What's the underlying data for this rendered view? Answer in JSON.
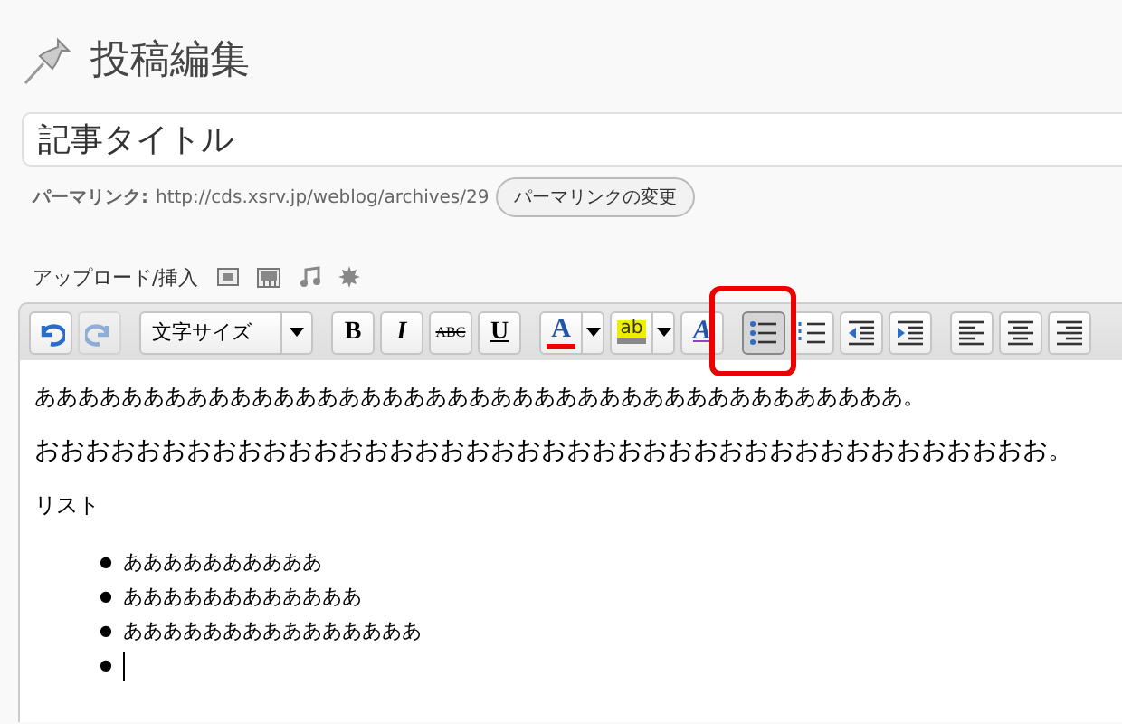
{
  "page_title": "投稿編集",
  "title_field": {
    "value": "記事タイトル"
  },
  "permalink": {
    "label": "パーマリンク:",
    "url": "http://cds.xsrv.jp/weblog/archives/29",
    "button": "パーマリンクの変更"
  },
  "upload": {
    "label": "アップロード/挿入"
  },
  "toolbar": [
    {
      "kind": "undo",
      "disabled": false,
      "selected": false
    },
    {
      "kind": "redo",
      "disabled": true,
      "selected": false
    },
    {
      "kind": "select",
      "label": "文字サイズ",
      "disabled": false,
      "selected": false
    },
    {
      "kind": "bold",
      "label": "B",
      "disabled": false,
      "selected": false
    },
    {
      "kind": "italic",
      "label": "I",
      "disabled": false,
      "selected": false
    },
    {
      "kind": "strike",
      "label": "ABC",
      "disabled": false,
      "selected": false
    },
    {
      "kind": "underline",
      "label": "U",
      "disabled": false,
      "selected": false
    },
    {
      "kind": "forecolor",
      "label": "A",
      "disabled": false,
      "selected": false
    },
    {
      "kind": "highlight",
      "label": "ab",
      "disabled": false,
      "selected": false
    },
    {
      "kind": "styles",
      "label": "A",
      "disabled": false,
      "selected": false
    },
    {
      "kind": "bullets",
      "disabled": false,
      "selected": true
    },
    {
      "kind": "numbers",
      "disabled": false,
      "selected": false
    },
    {
      "kind": "outdent",
      "disabled": false,
      "selected": false
    },
    {
      "kind": "indent",
      "disabled": false,
      "selected": false
    },
    {
      "kind": "alignleft",
      "disabled": false,
      "selected": false
    },
    {
      "kind": "aligncenter",
      "disabled": false,
      "selected": false
    },
    {
      "kind": "alignright",
      "disabled": false,
      "selected": false
    }
  ],
  "editor": {
    "paragraphs": [
      "ああああああああああああああああああああああああああああああああああああああああ。",
      "おおおおおおおおおおおおおおおおおおおおおおおおおおおおおおおおおおおおおおおお。",
      "リスト"
    ],
    "list_items": [
      {
        "marker": "●",
        "text": "ああああああああああ"
      },
      {
        "marker": "●",
        "text": "ああああああああああああ"
      },
      {
        "marker": "●",
        "text": "あああああああああああああああ"
      },
      {
        "marker": "●"
      }
    ]
  }
}
